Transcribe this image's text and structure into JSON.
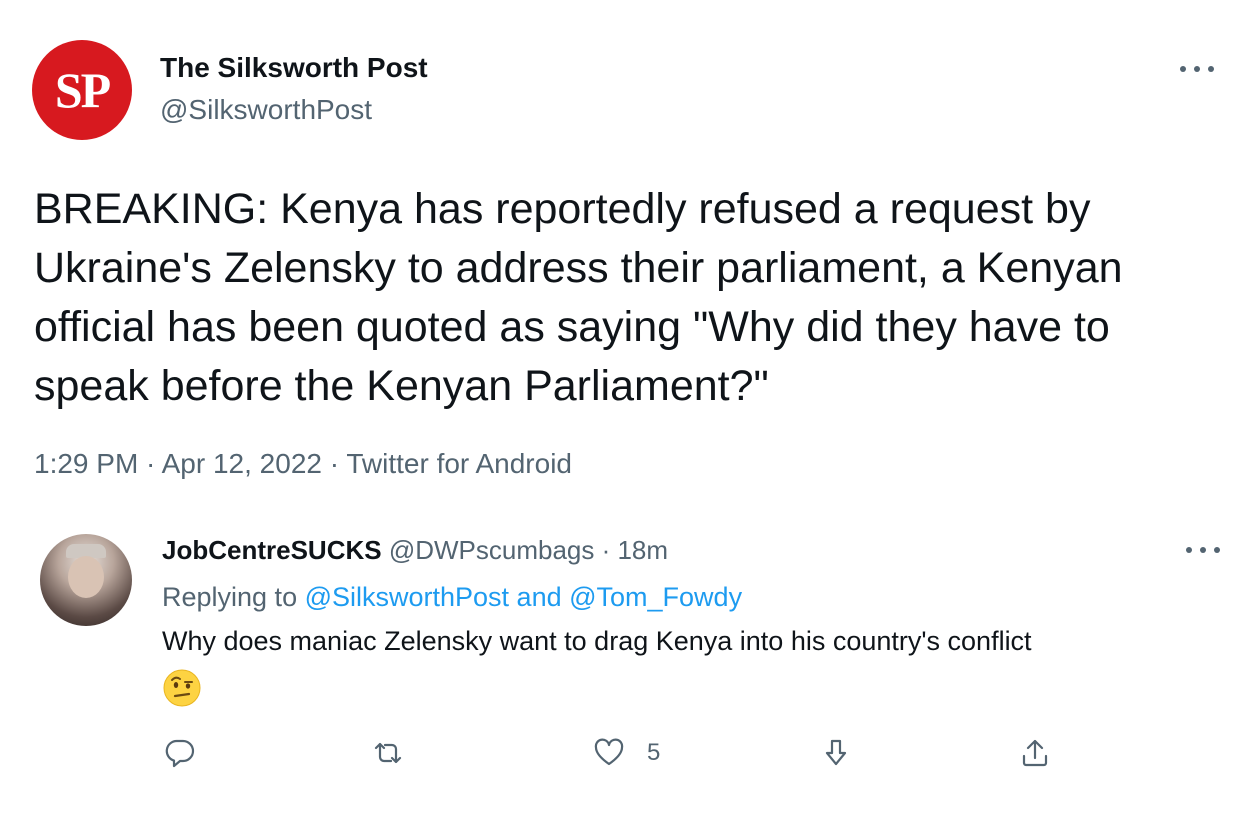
{
  "tweet": {
    "avatar_initials": "SP",
    "display_name": "The Silksworth Post",
    "handle": "@SilksworthPost",
    "text": "BREAKING: Kenya has reportedly refused a request by Ukraine's Zelensky to address their parliament, a Kenyan official has been quoted as saying \"Why did they have to speak before the Kenyan Parliament?\"",
    "meta": "1:29 PM · Apr 12, 2022 · Twitter for Android",
    "more_icon": "more-dots-icon"
  },
  "reply": {
    "display_name": "JobCentreSUCKS",
    "handle_time": " @DWPscumbags · 18m",
    "replying_prefix": "Replying to ",
    "replying_mentions": "@SilksworthPost and @Tom_Fowdy",
    "text": "Why does maniac Zelensky want to drag Kenya into his country's conflict",
    "emoji": "face-with-raised-eyebrow-emoji",
    "actions": {
      "reply_icon": "reply-icon",
      "retweet_icon": "retweet-icon",
      "like_icon": "heart-icon",
      "like_count": "5",
      "download_icon": "download-icon",
      "share_icon": "share-icon"
    }
  },
  "colors": {
    "brand_red": "#d7191f",
    "link_blue": "#1d9bf0",
    "secondary_text": "#536471",
    "primary_text": "#0f1419"
  }
}
